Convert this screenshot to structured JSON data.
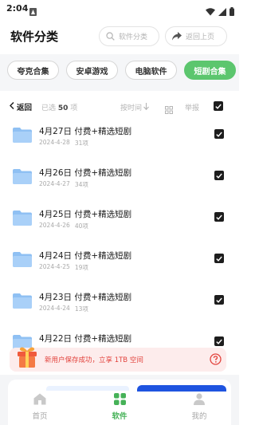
{
  "status_bar": {
    "time": "2:04",
    "icons": [
      "app-notification-icon",
      "wifi-icon",
      "cellular-icon",
      "battery-icon"
    ]
  },
  "header": {
    "title": "软件分类",
    "search_label": "软件分类",
    "back_top_label": "返回上页"
  },
  "category_tabs": [
    {
      "label": "夸克合集",
      "active": false
    },
    {
      "label": "安卓游戏",
      "active": false
    },
    {
      "label": "电脑软件",
      "active": false
    },
    {
      "label": "短剧合集",
      "active": true
    }
  ],
  "toolbar": {
    "back_label": "返回",
    "selected_prefix": "已选",
    "selected_count": "50",
    "selected_suffix": "项",
    "sort_label": "按时间",
    "report_label": "举报"
  },
  "files": [
    {
      "name": "4月27日 付费+精选短剧",
      "date": "2024-4-28",
      "count": "31项",
      "checked": true
    },
    {
      "name": "4月26日 付费+精选短剧",
      "date": "2024-4-27",
      "count": "34项",
      "checked": true
    },
    {
      "name": "4月25日 付费+精选短剧",
      "date": "2024-4-26",
      "count": "40项",
      "checked": true
    },
    {
      "name": "4月24日 付费+精选短剧",
      "date": "2024-4-25",
      "count": "19项",
      "checked": true
    },
    {
      "name": "4月23日 付费+精选短剧",
      "date": "2024-4-24",
      "count": "13项",
      "checked": true
    },
    {
      "name": "4月22日 付费+精选短剧",
      "date": "",
      "count": "",
      "checked": true
    }
  ],
  "promo": {
    "text": "新用户保存成功，立享 1TB 空间"
  },
  "bottom_nav": [
    {
      "label": "首页",
      "icon": "home-icon",
      "active": false
    },
    {
      "label": "软件",
      "icon": "apps-grid-icon",
      "active": true
    },
    {
      "label": "我的",
      "icon": "profile-icon",
      "active": false
    }
  ],
  "colors": {
    "accent_green": "#5cc66e",
    "nav_active": "#46b258",
    "promo_red": "#e2423c",
    "primary_blue": "#1f54e0"
  }
}
